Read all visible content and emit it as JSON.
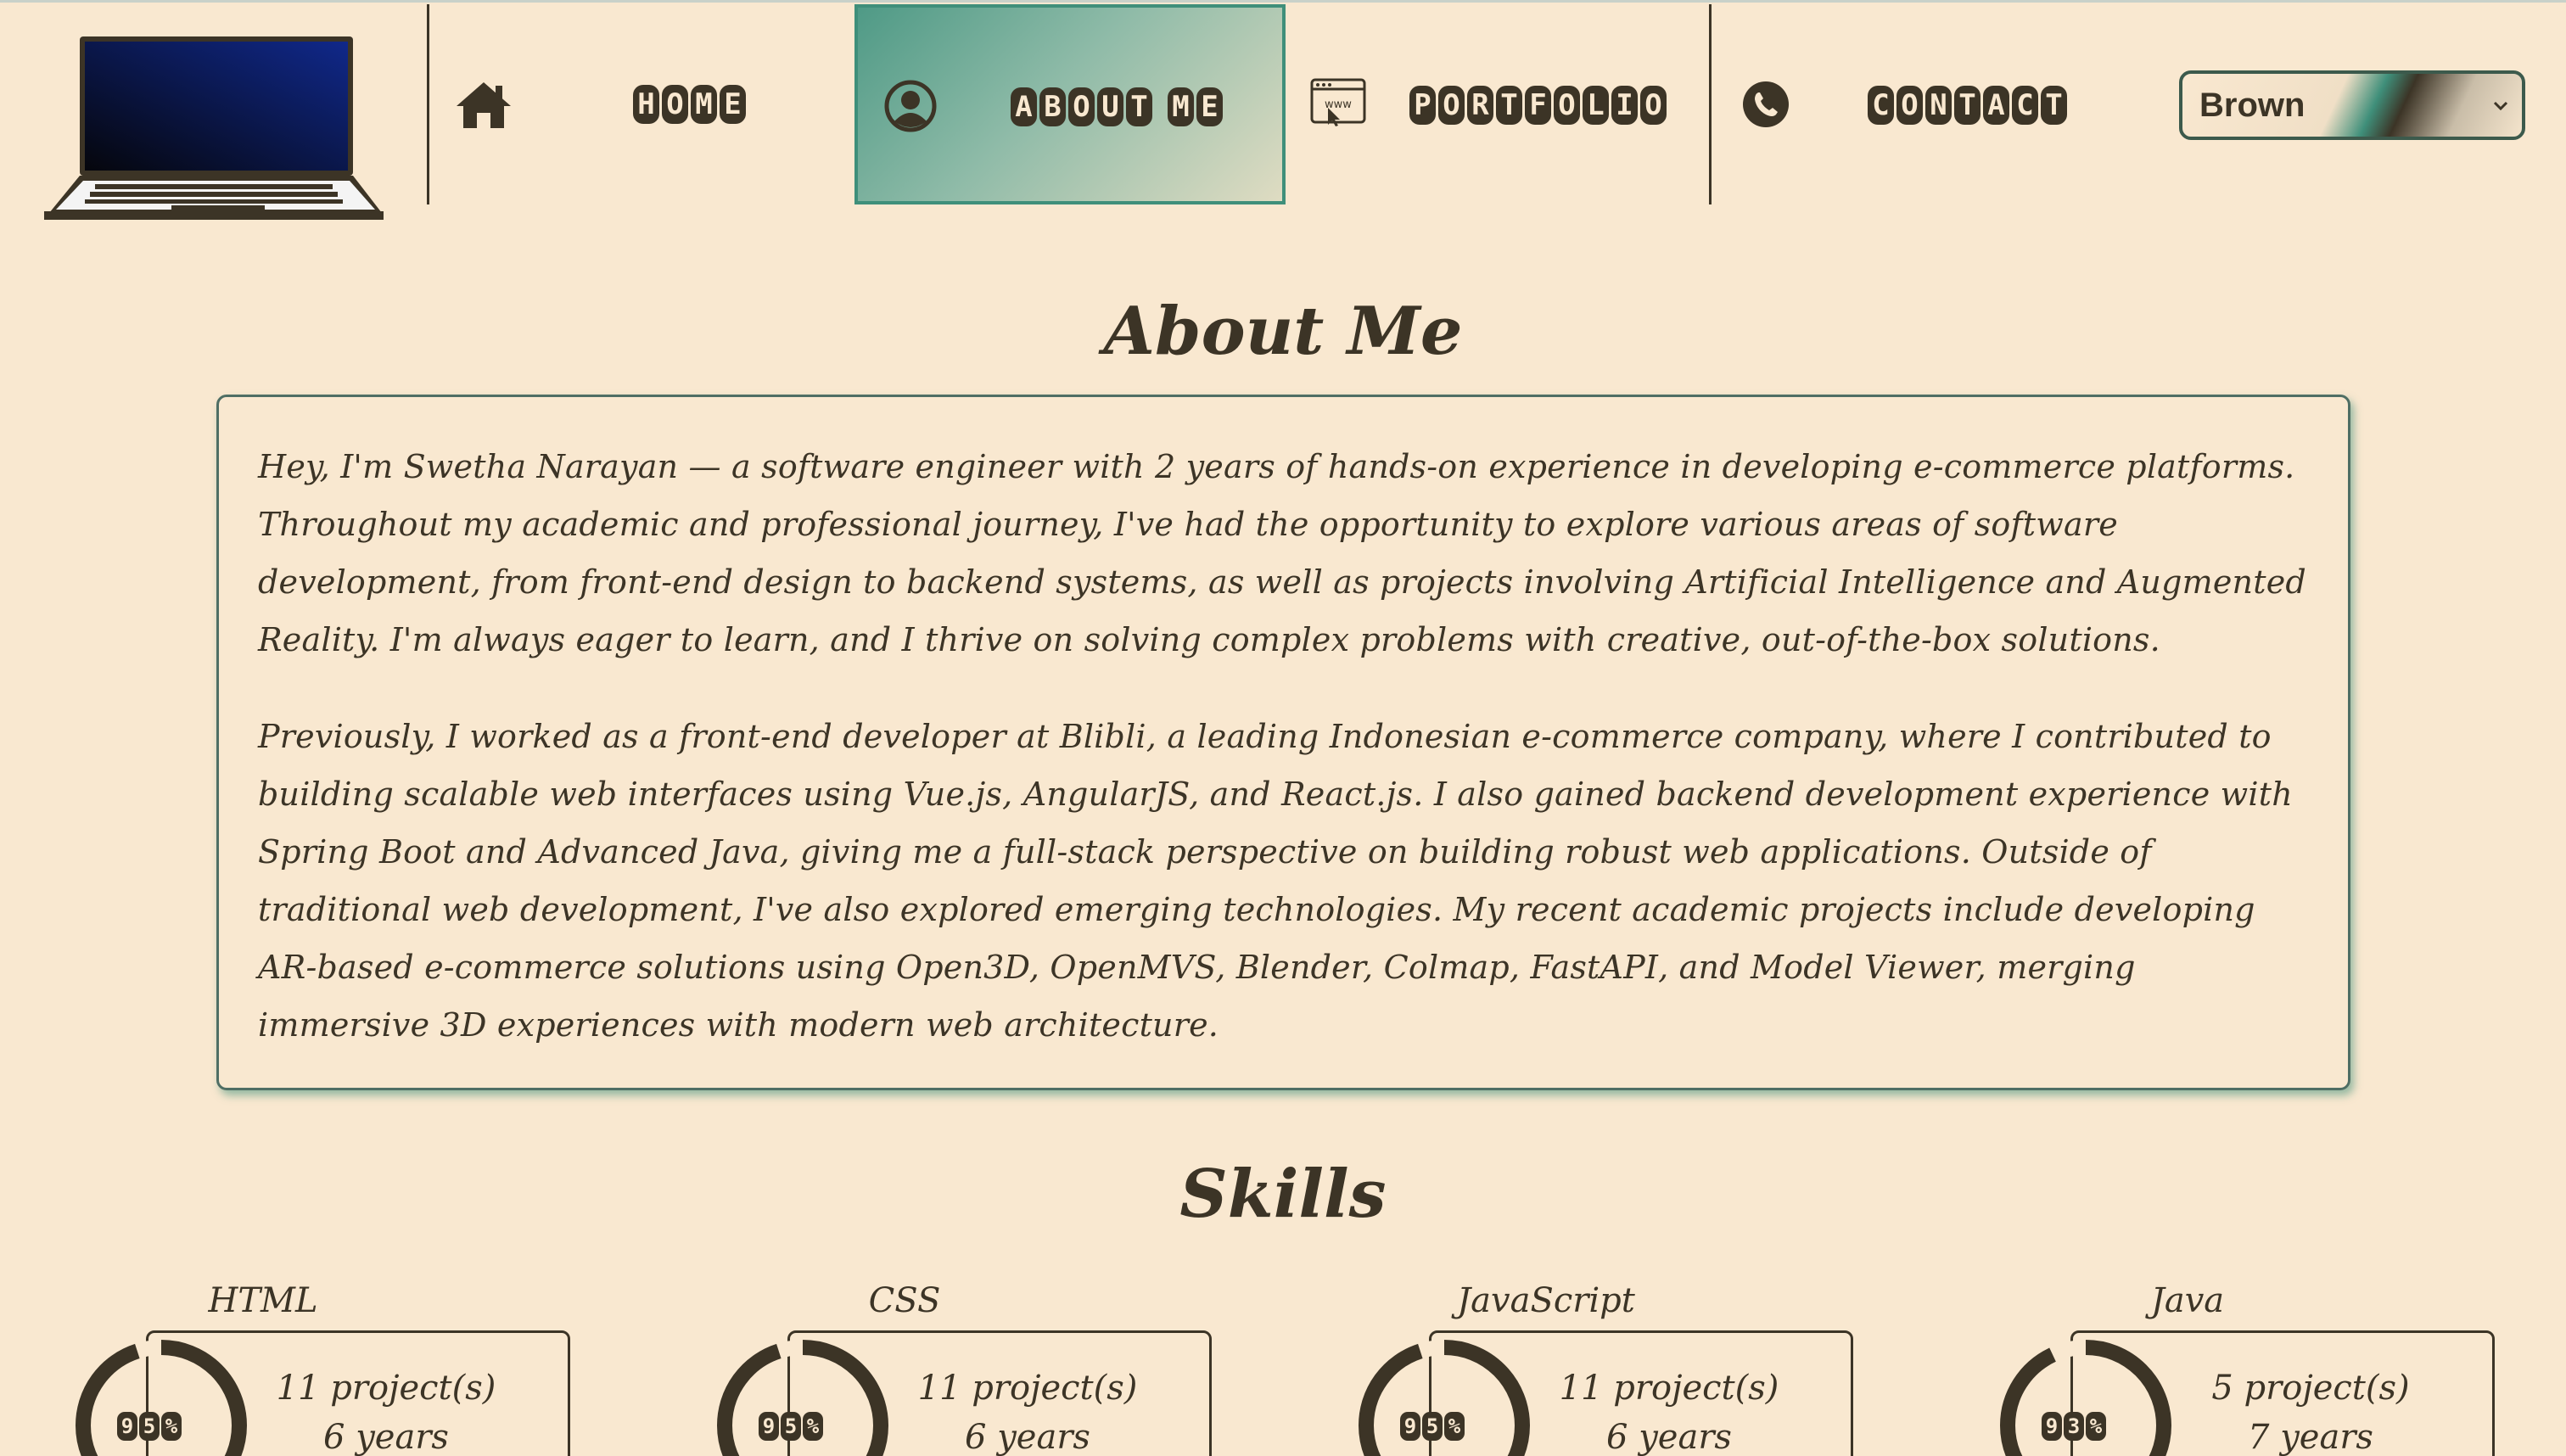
{
  "nav": {
    "items": [
      {
        "label": "HOME",
        "icon": "home-icon"
      },
      {
        "label": "ABOUT ME",
        "icon": "user-circle-icon"
      },
      {
        "label": "PORTFOLIO",
        "icon": "browser-www-icon"
      },
      {
        "label": "CONTACT",
        "icon": "phone-icon"
      }
    ],
    "active_index": 1,
    "theme_select": {
      "value": "Brown"
    }
  },
  "about": {
    "title": "About Me",
    "paragraphs": [
      "Hey, I'm Swetha Narayan — a software engineer with 2 years of hands-on experience in developing e-commerce platforms. Throughout my academic and professional journey, I've had the opportunity to explore various areas of software development, from front-end design to backend systems, as well as projects involving Artificial Intelligence and Augmented Reality. I'm always eager to learn, and I thrive on solving complex problems with creative, out-of-the-box solutions.",
      "Previously, I worked as a front-end developer at Blibli, a leading Indonesian e-commerce company, where I contributed to building scalable web interfaces using Vue.js, AngularJS, and React.js. I also gained backend development experience with Spring Boot and Advanced Java, giving me a full-stack perspective on building robust web applications. Outside of traditional web development, I've also explored emerging technologies. My recent academic projects include developing AR-based e-commerce solutions using Open3D, OpenMVS, Blender, Colmap, FastAPI, and Model Viewer, merging immersive 3D experiences with modern web architecture."
    ]
  },
  "skills": {
    "title": "Skills",
    "items": [
      {
        "name": "HTML",
        "percent": "95%",
        "projects": "11 project(s)",
        "years": "6 years"
      },
      {
        "name": "CSS",
        "percent": "95%",
        "projects": "11 project(s)",
        "years": "6 years"
      },
      {
        "name": "JavaScript",
        "percent": "95%",
        "projects": "11 project(s)",
        "years": "6 years"
      },
      {
        "name": "Java",
        "percent": "93%",
        "projects": "5 project(s)",
        "years": "7 years"
      }
    ]
  },
  "colors": {
    "background": "#f9e8d0",
    "text": "#3c3426",
    "accent": "#3f8f7a"
  }
}
